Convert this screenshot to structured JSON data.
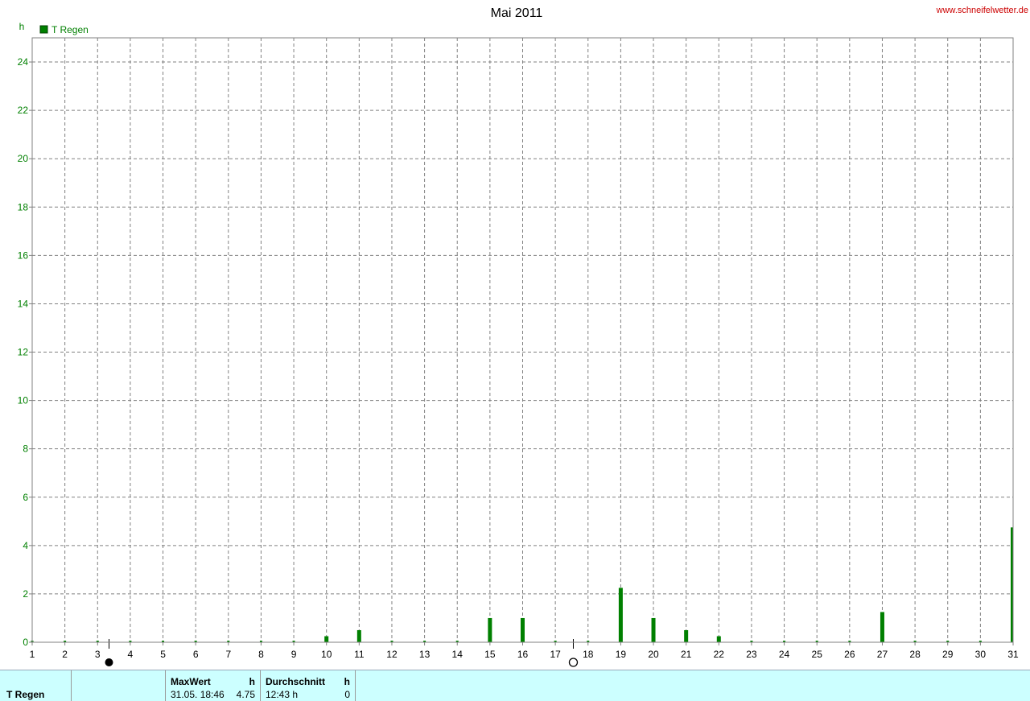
{
  "header": {
    "title": "Mai 2011",
    "site": "www.schneifelwetter.de"
  },
  "colors": {
    "series": "#008000",
    "panel_bg": "#ccffff",
    "site_text": "#cc0000"
  },
  "moon_icons": [
    {
      "day": 3.35,
      "icon": "new-moon-icon"
    },
    {
      "day": 17.55,
      "icon": "full-moon-icon"
    }
  ],
  "chart_data": {
    "type": "bar",
    "y_unit": "h",
    "legend": [
      {
        "name": "T Regen",
        "color": "#008000"
      }
    ],
    "series": [
      {
        "name": "T Regen",
        "x": [
          1,
          2,
          3,
          4,
          5,
          6,
          7,
          8,
          9,
          10,
          11,
          12,
          13,
          14,
          15,
          16,
          17,
          18,
          19,
          20,
          21,
          22,
          23,
          24,
          25,
          26,
          27,
          28,
          29,
          30,
          31
        ],
        "values": [
          0,
          0,
          0,
          0,
          0,
          0,
          0,
          0,
          0,
          0.25,
          0.5,
          0,
          0,
          0,
          1.0,
          1.0,
          0,
          0,
          2.25,
          1.0,
          0.5,
          0.25,
          0,
          0,
          0,
          0,
          1.25,
          0,
          0,
          0,
          4.75
        ]
      }
    ],
    "xlim": [
      1,
      31
    ],
    "ylim": [
      0,
      25
    ],
    "x_ticks": [
      1,
      2,
      3,
      4,
      5,
      6,
      7,
      8,
      9,
      10,
      11,
      12,
      13,
      14,
      15,
      16,
      17,
      18,
      19,
      20,
      21,
      22,
      23,
      24,
      25,
      26,
      27,
      28,
      29,
      30,
      31
    ],
    "y_ticks": [
      0,
      2,
      4,
      6,
      8,
      10,
      12,
      14,
      16,
      18,
      20,
      22,
      24
    ],
    "grid": true,
    "legend_position": "top-left"
  },
  "stats": {
    "series_label": "T Regen",
    "max_header": "MaxWert",
    "max_unit": "h",
    "max_datetime": "31.05.  18:46",
    "max_value": "4.75",
    "avg_header": "Durchschnitt",
    "avg_unit": "h",
    "avg_value_text": "12:43 h",
    "avg_value": "0"
  }
}
